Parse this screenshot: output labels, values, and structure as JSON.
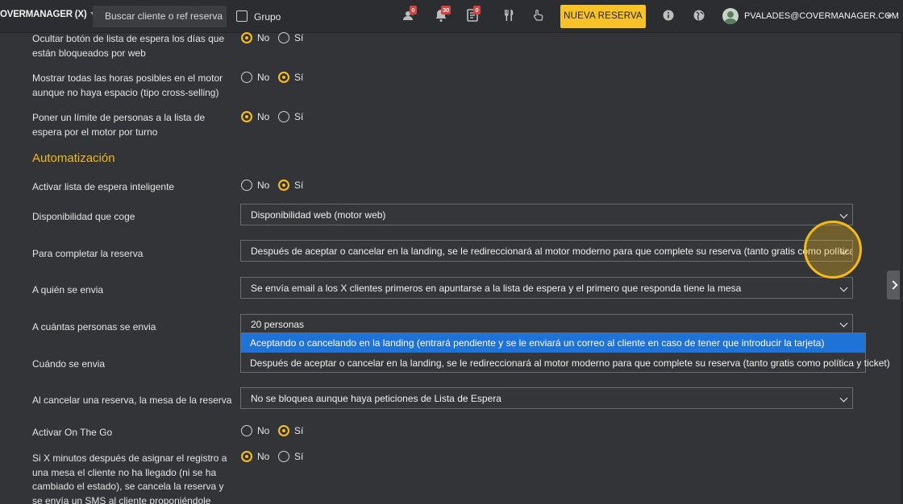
{
  "topbar": {
    "brand": "OVERMANAGER (X)",
    "search_placeholder": "Buscar cliente o ref reserva",
    "grupo_label": "Grupo",
    "badges": {
      "guests": "0",
      "notifications": "30",
      "list": "0"
    },
    "icons": [
      "people-icon",
      "bell-icon",
      "list-icon",
      "utensils-icon",
      "hand-icon",
      "info-icon",
      "globe-icon"
    ],
    "new_reservation_label": "NUEVA RESERVA",
    "user_email": "PVALADES@COVERMANAGER.COM"
  },
  "radio_options": {
    "no": "No",
    "si": "Sí"
  },
  "settings": [
    {
      "label": "Ocultar botón de lista de espera los días que están bloqueados por web",
      "selected": "No"
    },
    {
      "label": "Mostrar todas las horas posibles en el motor aunque no haya espacio (tipo cross-selling)",
      "selected": "Sí"
    },
    {
      "label": "Poner un límite de personas a la lista de espera por el motor por turno",
      "selected": "No"
    }
  ],
  "section_title": "Automatización",
  "automation": {
    "activar_lista": {
      "label": "Activar lista de espera inteligente",
      "selected": "Sí"
    },
    "disponibilidad": {
      "label": "Disponibilidad que coge",
      "value": "Disponibilidad web (motor web)"
    },
    "completar": {
      "label": "Para completar la reserva",
      "value": "Después de aceptar o cancelar en la landing, se le redireccionará al motor moderno para que complete su reserva (tanto gratis como política y ticket)"
    },
    "a_quien": {
      "label": "A quién se envia",
      "value": "Se envía email a los X clientes primeros en apuntarse a la lista de espera y el primero que responda tiene la mesa"
    },
    "cuantas": {
      "label": "A cuántas personas se envia",
      "value": "20 personas"
    },
    "cuando": {
      "label": "Cuándo se envia"
    },
    "dropdown_options": [
      "Aceptando o cancelando en la landing (entrará pendiente y se le enviará un correo al cliente en caso de tener que introducir la tarjeta)",
      "Después de aceptar o cancelar en la landing, se le redireccionará al motor moderno para que complete su reserva (tanto gratis como política y ticket)"
    ],
    "al_cancelar": {
      "label": "Al cancelar una reserva, la mesa de la reserva",
      "value": "No se bloquea aunque haya peticiones de Lista de Espera"
    },
    "on_the_go": {
      "label": "Activar On The Go",
      "selected": "Sí"
    },
    "x_minutos": {
      "label": "Si X minutos después de asignar el registro a una mesa el cliente no ha llegado (ni se ha cambiado el estado), se cancela la reserva y se envía un SMS al cliente proponiéndole volver",
      "selected": "No"
    }
  },
  "colors": {
    "accent": "#f5bd1f",
    "highlight": "#1f73d6",
    "background": "#333437"
  }
}
